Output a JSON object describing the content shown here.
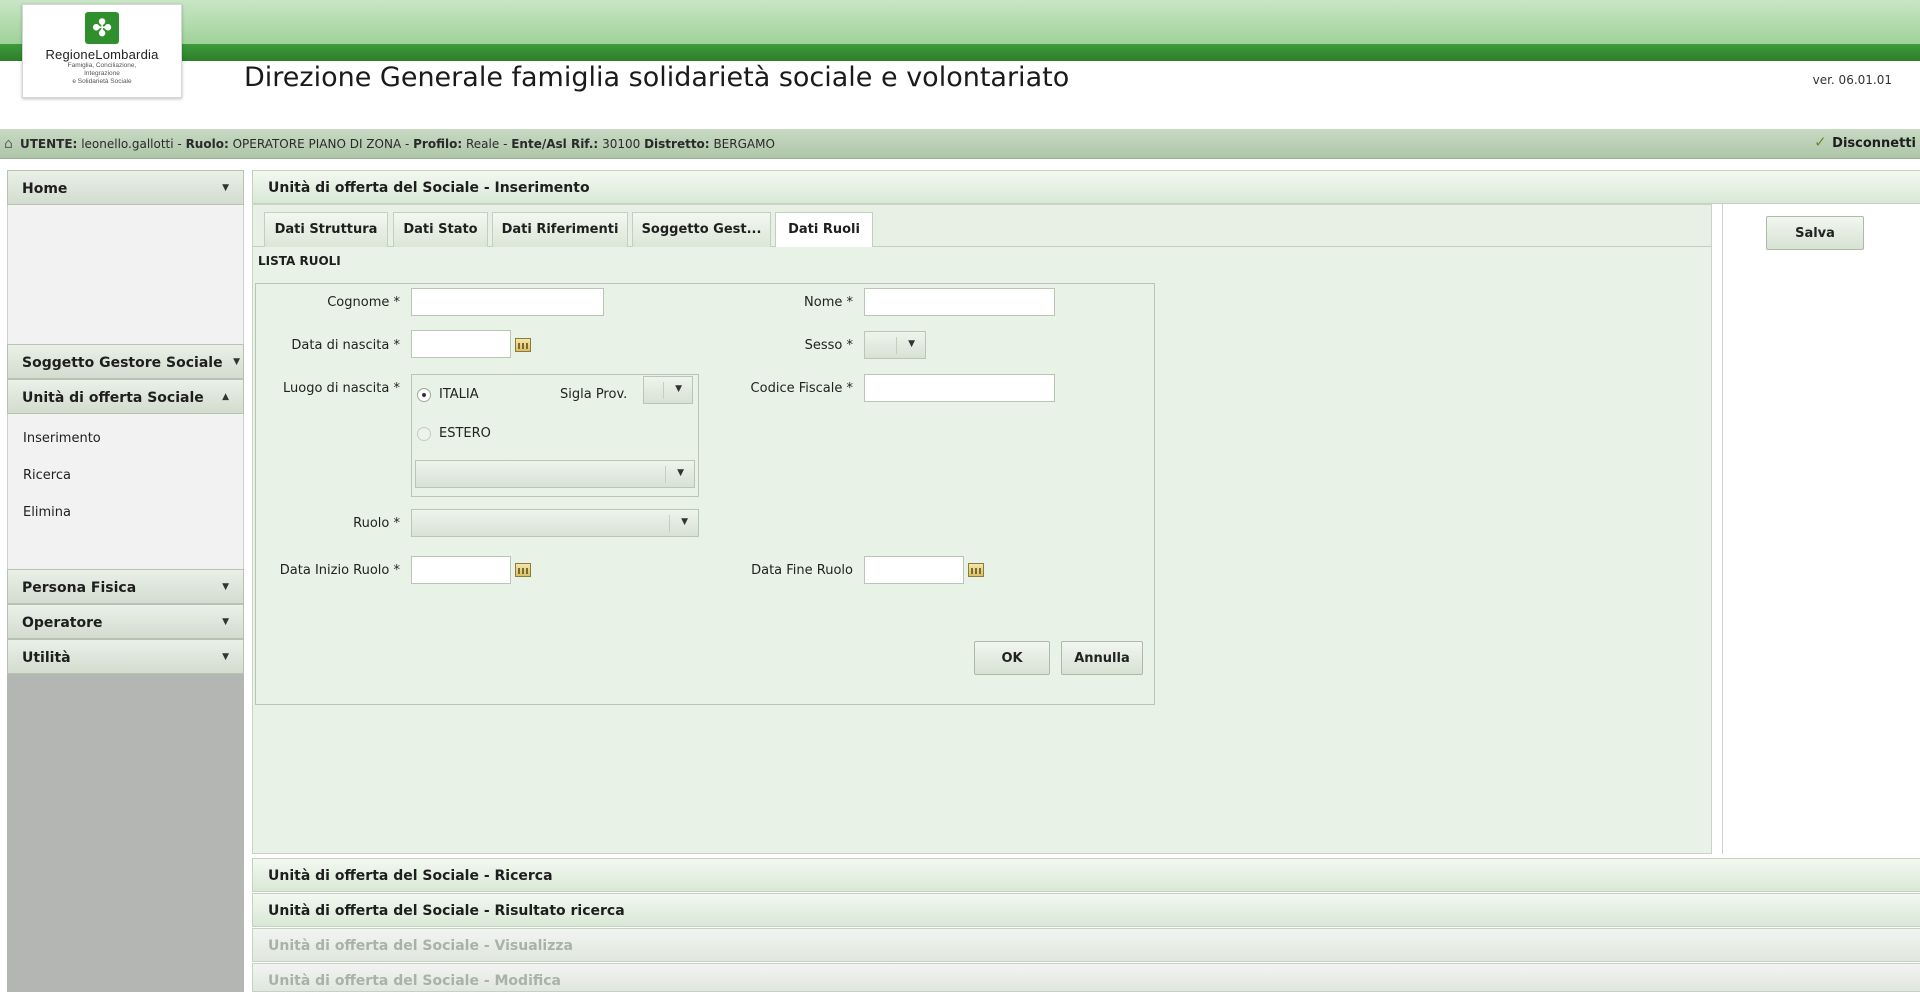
{
  "header": {
    "logo_name": "RegioneLombardia",
    "logo_sub": "Famiglia, Conciliazione,\nIntegrazione\ne Solidarietà Sociale",
    "title": "Direzione Generale famiglia solidarietà sociale e volontariato",
    "version": "ver. 06.01.01"
  },
  "userbar": {
    "utente_label": "UTENTE:",
    "utente": "leonello.gallotti",
    "sep1": " - ",
    "ruolo_label": "Ruolo:",
    "ruolo": "OPERATORE PIANO DI ZONA",
    "sep2": " - ",
    "profilo_label": "Profilo:",
    "profilo": "Reale",
    "sep3": " - ",
    "ente_label": "Ente/Asl Rif.:",
    "ente": "30100",
    "distretto_label": "Distretto:",
    "distretto": "BERGAMO",
    "logout": "Disconnetti"
  },
  "sidebar": {
    "home": "Home",
    "soggetto": "Soggetto Gestore Sociale",
    "unita": "Unità di offerta Sociale",
    "links": [
      "Inserimento",
      "Ricerca",
      "Elimina"
    ],
    "persona": "Persona Fisica",
    "operatore": "Operatore",
    "utilita": "Utilità"
  },
  "panels": {
    "inserimento": "Unità di offerta del Sociale - Inserimento",
    "ricerca": "Unità di offerta del Sociale - Ricerca",
    "risultato": "Unità di offerta del Sociale - Risultato ricerca",
    "visualizza": "Unità di offerta del Sociale - Visualizza",
    "modifica": "Unità di offerta del Sociale - Modifica"
  },
  "tabs": [
    "Dati Struttura",
    "Dati Stato",
    "Dati Riferimenti",
    "Soggetto Gest...",
    "Dati Ruoli"
  ],
  "active_tab": "Dati Ruoli",
  "lista_label": "LISTA RUOLI",
  "form": {
    "cognome_label": "Cognome *",
    "cognome_value": "",
    "nome_label": "Nome *",
    "nome_value": "",
    "data_nascita_label": "Data di nascita *",
    "data_nascita_value": "",
    "sesso_label": "Sesso *",
    "sesso_value": "",
    "luogo_label": "Luogo di nascita *",
    "radio_italia": "ITALIA",
    "radio_estero": "ESTERO",
    "selected_luogo": "ITALIA",
    "sigla_label": "Sigla Prov.",
    "sigla_value": "",
    "comune_value": "",
    "codice_fiscale_label": "Codice Fiscale *",
    "codice_fiscale_value": "",
    "ruolo_label": "Ruolo *",
    "ruolo_value": "",
    "data_inizio_label": "Data Inizio Ruolo *",
    "data_inizio_value": "",
    "data_fine_label": "Data Fine Ruolo",
    "data_fine_value": "",
    "ok": "OK",
    "annulla": "Annulla"
  },
  "salva": "Salva",
  "colors": {
    "brand_green": "#2f8f2c",
    "header_light": "#9fd19a",
    "panel_bg": "#e9f2e6",
    "sidebar_bg": "#b3b6b3",
    "disabled_text": "#a8b3a6"
  },
  "icons": {
    "logo": "regione-lombardia-logo",
    "user": "user-icon",
    "logout": "logout-icon",
    "calendar": "calendar-icon",
    "dropdown": "chevron-down-icon",
    "collapse": "chevron-up-icon"
  }
}
